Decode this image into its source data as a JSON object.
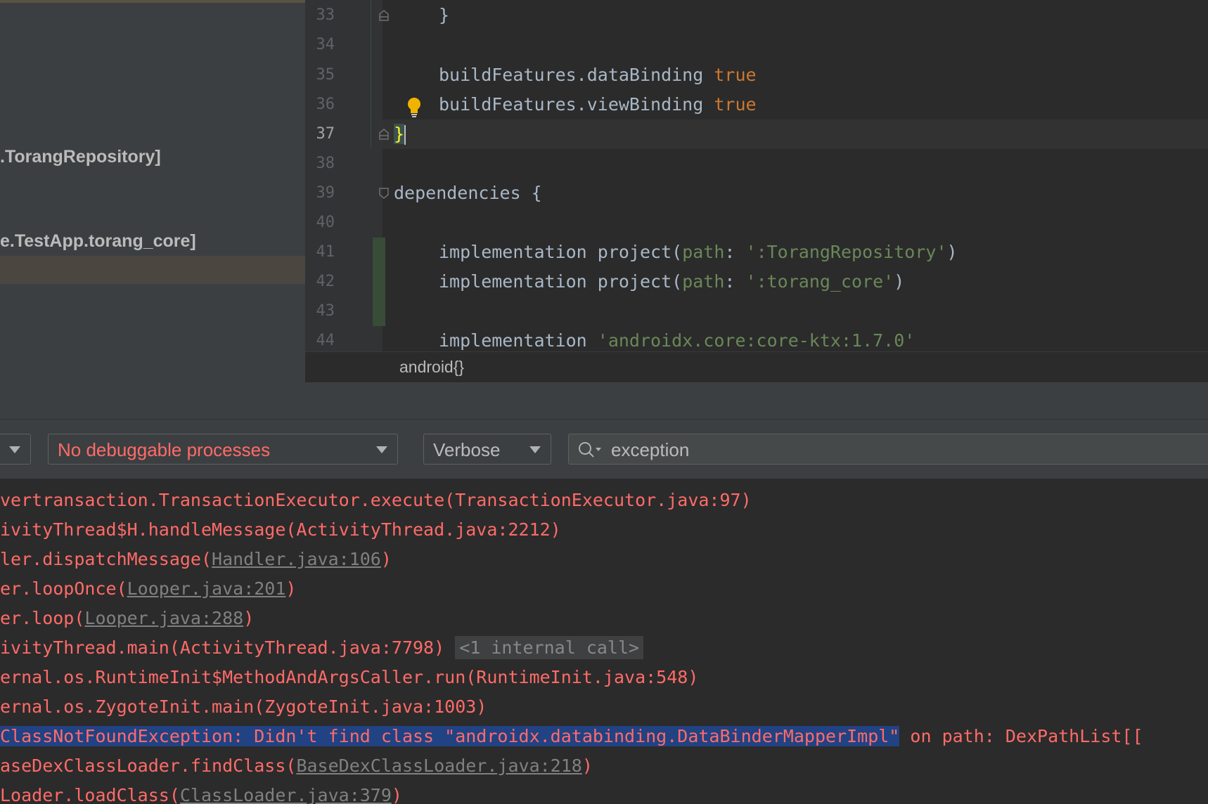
{
  "project_tree": {
    "items": [
      ".TorangRepository]",
      "e.TestApp.torang_core]"
    ]
  },
  "editor": {
    "line_numbers": [
      "33",
      "34",
      "35",
      "36",
      "37",
      "38",
      "39",
      "40",
      "41",
      "42",
      "43",
      "44"
    ],
    "lines": {
      "l33": "}",
      "l35_code": "buildFeatures.dataBinding ",
      "l35_kw": "true",
      "l36_code": "buildFeatures.viewBinding ",
      "l36_kw": "true",
      "l37": "}",
      "l39": "dependencies {",
      "l41_a": "implementation project(",
      "l41_named": "path",
      "l41_b": ": ",
      "l41_str": "':TorangRepository'",
      "l41_c": ")",
      "l42_a": "implementation project(",
      "l42_named": "path",
      "l42_b": ": ",
      "l42_str": "':torang_core'",
      "l42_c": ")",
      "l44_a": "implementation ",
      "l44_str": "'androidx.core:core-ktx:1.7.0'"
    },
    "breadcrumb": "android{}"
  },
  "logcat": {
    "process_combo": "No debuggable processes",
    "level_combo": "Verbose",
    "search_value": "exception",
    "colors": {
      "error": "#ff6b68",
      "selection": "#214283",
      "keyword": "#cc7832",
      "string": "#6a8759"
    },
    "lines": {
      "l1": "vertransaction.TransactionExecutor.execute(TransactionExecutor.java:97)",
      "l2": "ivityThread$H.handleMessage(ActivityThread.java:2212)",
      "l3_a": "ler.dispatchMessage(",
      "l3_link": "Handler.java:106",
      "l3_b": ")",
      "l4_a": "er.loopOnce(",
      "l4_link": "Looper.java:201",
      "l4_b": ")",
      "l5_a": "er.loop(",
      "l5_link": "Looper.java:288",
      "l5_b": ")",
      "l6_a": "ivityThread.main(ActivityThread.java:7798)",
      "l6_badge": "<1 internal call>",
      "l7": "ernal.os.RuntimeInit$MethodAndArgsCaller.run(RuntimeInit.java:548)",
      "l8": "ernal.os.ZygoteInit.main(ZygoteInit.java:1003)",
      "l9_sel": "ClassNotFoundException: Didn't find class \"androidx.databinding.DataBinderMapperImpl\"",
      "l9_rest": " on path: DexPathList[[",
      "l10_a": "aseDexClassLoader.findClass(",
      "l10_link": "BaseDexClassLoader.java:218",
      "l10_b": ")",
      "l11_a": "Loader.loadClass(",
      "l11_link": "ClassLoader.java:379",
      "l11_b": ")"
    }
  }
}
